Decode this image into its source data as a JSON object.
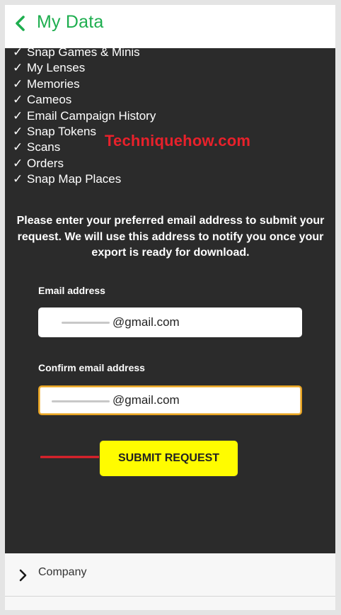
{
  "header": {
    "title": "My Data",
    "accent_color": "#1eae4f",
    "back_icon": "chevron-left-icon"
  },
  "export_categories": [
    {
      "label": "Snap Games & Minis"
    },
    {
      "label": "My Lenses"
    },
    {
      "label": "Memories"
    },
    {
      "label": "Cameos"
    },
    {
      "label": "Email Campaign History"
    },
    {
      "label": "Snap Tokens"
    },
    {
      "label": "Scans"
    },
    {
      "label": "Orders"
    },
    {
      "label": "Snap Map Places"
    }
  ],
  "check_glyph": "✓",
  "watermark": "Techniquehow.com",
  "instructions": "Please enter your preferred email address to submit your request. We will use this address to notify you once your export is ready for download.",
  "form": {
    "email_label": "Email address",
    "email_value": "@gmail.com",
    "confirm_label": "Confirm email address",
    "confirm_value": "@gmail.com",
    "focus_color": "#e7a322"
  },
  "submit_label": "SUBMIT REQUEST",
  "submit_color": "#fffc00",
  "annotation_arrow_color": "#e8212b",
  "footer": {
    "company_label": "Company",
    "chevron_icon": "chevron-right-icon"
  }
}
